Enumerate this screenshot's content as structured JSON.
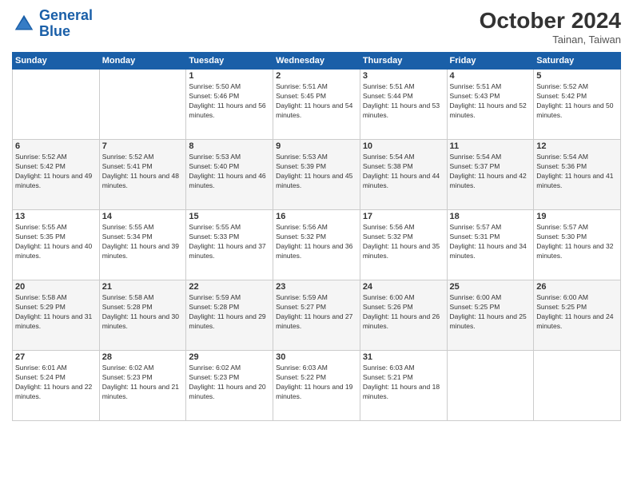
{
  "header": {
    "logo_line1": "General",
    "logo_line2": "Blue",
    "month": "October 2024",
    "location": "Tainan, Taiwan"
  },
  "weekdays": [
    "Sunday",
    "Monday",
    "Tuesday",
    "Wednesday",
    "Thursday",
    "Friday",
    "Saturday"
  ],
  "weeks": [
    [
      {
        "day": "",
        "info": ""
      },
      {
        "day": "",
        "info": ""
      },
      {
        "day": "1",
        "info": "Sunrise: 5:50 AM\nSunset: 5:46 PM\nDaylight: 11 hours and 56 minutes."
      },
      {
        "day": "2",
        "info": "Sunrise: 5:51 AM\nSunset: 5:45 PM\nDaylight: 11 hours and 54 minutes."
      },
      {
        "day": "3",
        "info": "Sunrise: 5:51 AM\nSunset: 5:44 PM\nDaylight: 11 hours and 53 minutes."
      },
      {
        "day": "4",
        "info": "Sunrise: 5:51 AM\nSunset: 5:43 PM\nDaylight: 11 hours and 52 minutes."
      },
      {
        "day": "5",
        "info": "Sunrise: 5:52 AM\nSunset: 5:42 PM\nDaylight: 11 hours and 50 minutes."
      }
    ],
    [
      {
        "day": "6",
        "info": "Sunrise: 5:52 AM\nSunset: 5:42 PM\nDaylight: 11 hours and 49 minutes."
      },
      {
        "day": "7",
        "info": "Sunrise: 5:52 AM\nSunset: 5:41 PM\nDaylight: 11 hours and 48 minutes."
      },
      {
        "day": "8",
        "info": "Sunrise: 5:53 AM\nSunset: 5:40 PM\nDaylight: 11 hours and 46 minutes."
      },
      {
        "day": "9",
        "info": "Sunrise: 5:53 AM\nSunset: 5:39 PM\nDaylight: 11 hours and 45 minutes."
      },
      {
        "day": "10",
        "info": "Sunrise: 5:54 AM\nSunset: 5:38 PM\nDaylight: 11 hours and 44 minutes."
      },
      {
        "day": "11",
        "info": "Sunrise: 5:54 AM\nSunset: 5:37 PM\nDaylight: 11 hours and 42 minutes."
      },
      {
        "day": "12",
        "info": "Sunrise: 5:54 AM\nSunset: 5:36 PM\nDaylight: 11 hours and 41 minutes."
      }
    ],
    [
      {
        "day": "13",
        "info": "Sunrise: 5:55 AM\nSunset: 5:35 PM\nDaylight: 11 hours and 40 minutes."
      },
      {
        "day": "14",
        "info": "Sunrise: 5:55 AM\nSunset: 5:34 PM\nDaylight: 11 hours and 39 minutes."
      },
      {
        "day": "15",
        "info": "Sunrise: 5:55 AM\nSunset: 5:33 PM\nDaylight: 11 hours and 37 minutes."
      },
      {
        "day": "16",
        "info": "Sunrise: 5:56 AM\nSunset: 5:32 PM\nDaylight: 11 hours and 36 minutes."
      },
      {
        "day": "17",
        "info": "Sunrise: 5:56 AM\nSunset: 5:32 PM\nDaylight: 11 hours and 35 minutes."
      },
      {
        "day": "18",
        "info": "Sunrise: 5:57 AM\nSunset: 5:31 PM\nDaylight: 11 hours and 34 minutes."
      },
      {
        "day": "19",
        "info": "Sunrise: 5:57 AM\nSunset: 5:30 PM\nDaylight: 11 hours and 32 minutes."
      }
    ],
    [
      {
        "day": "20",
        "info": "Sunrise: 5:58 AM\nSunset: 5:29 PM\nDaylight: 11 hours and 31 minutes."
      },
      {
        "day": "21",
        "info": "Sunrise: 5:58 AM\nSunset: 5:28 PM\nDaylight: 11 hours and 30 minutes."
      },
      {
        "day": "22",
        "info": "Sunrise: 5:59 AM\nSunset: 5:28 PM\nDaylight: 11 hours and 29 minutes."
      },
      {
        "day": "23",
        "info": "Sunrise: 5:59 AM\nSunset: 5:27 PM\nDaylight: 11 hours and 27 minutes."
      },
      {
        "day": "24",
        "info": "Sunrise: 6:00 AM\nSunset: 5:26 PM\nDaylight: 11 hours and 26 minutes."
      },
      {
        "day": "25",
        "info": "Sunrise: 6:00 AM\nSunset: 5:25 PM\nDaylight: 11 hours and 25 minutes."
      },
      {
        "day": "26",
        "info": "Sunrise: 6:00 AM\nSunset: 5:25 PM\nDaylight: 11 hours and 24 minutes."
      }
    ],
    [
      {
        "day": "27",
        "info": "Sunrise: 6:01 AM\nSunset: 5:24 PM\nDaylight: 11 hours and 22 minutes."
      },
      {
        "day": "28",
        "info": "Sunrise: 6:02 AM\nSunset: 5:23 PM\nDaylight: 11 hours and 21 minutes."
      },
      {
        "day": "29",
        "info": "Sunrise: 6:02 AM\nSunset: 5:23 PM\nDaylight: 11 hours and 20 minutes."
      },
      {
        "day": "30",
        "info": "Sunrise: 6:03 AM\nSunset: 5:22 PM\nDaylight: 11 hours and 19 minutes."
      },
      {
        "day": "31",
        "info": "Sunrise: 6:03 AM\nSunset: 5:21 PM\nDaylight: 11 hours and 18 minutes."
      },
      {
        "day": "",
        "info": ""
      },
      {
        "day": "",
        "info": ""
      }
    ]
  ]
}
